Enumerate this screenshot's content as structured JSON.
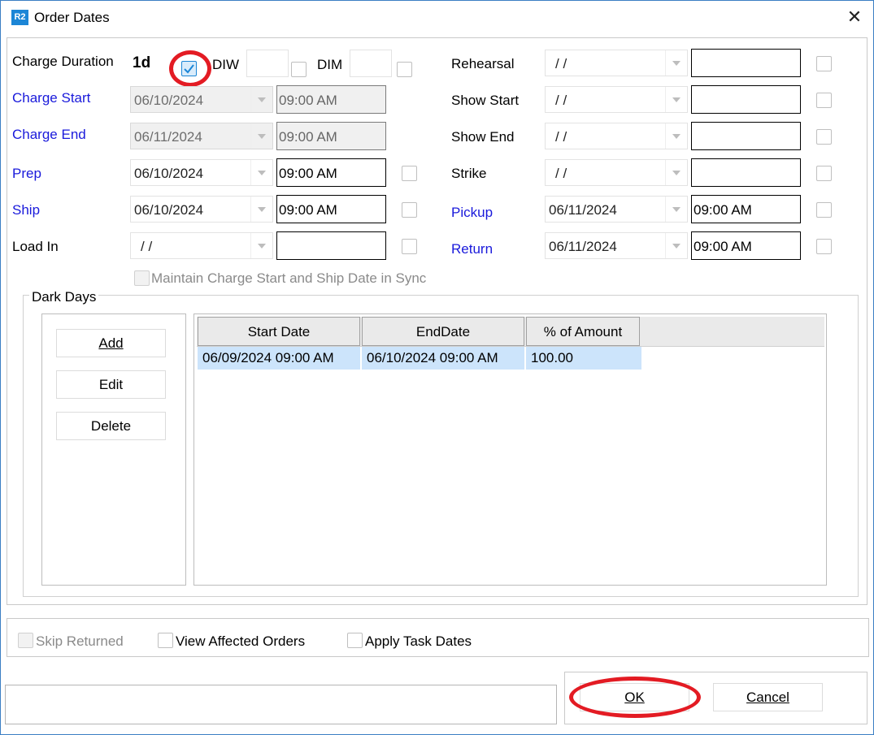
{
  "window": {
    "app_icon_text": "R2",
    "title": "Order Dates",
    "close_glyph": "✕"
  },
  "top": {
    "charge_duration_label": "Charge Duration",
    "charge_duration_value": "1d",
    "diw_label": "DIW",
    "dim_label": "DIM"
  },
  "left_rows": [
    {
      "label": "Charge Start",
      "date": "06/10/2024",
      "time": "09:00 AM"
    },
    {
      "label": "Charge End",
      "date": "06/11/2024",
      "time": "09:00 AM"
    },
    {
      "label": "Prep",
      "date": "06/10/2024",
      "time": "09:00 AM"
    },
    {
      "label": "Ship",
      "date": "06/10/2024",
      "time": "09:00 AM"
    },
    {
      "label": "Load In",
      "date": " /  /",
      "time": ""
    }
  ],
  "right_rows": [
    {
      "label": "Rehearsal",
      "date": " /  /",
      "time": ""
    },
    {
      "label": "Show Start",
      "date": " /  /",
      "time": ""
    },
    {
      "label": "Show End",
      "date": " /  /",
      "time": ""
    },
    {
      "label": "Strike",
      "date": " /  /",
      "time": ""
    },
    {
      "label": "Pickup",
      "date": "06/11/2024",
      "time": "09:00 AM"
    },
    {
      "label": "Return",
      "date": "06/11/2024",
      "time": "09:00 AM"
    }
  ],
  "maintain_sync_label": "Maintain Charge Start and Ship Date in Sync",
  "dark_days": {
    "group_label": "Dark Days",
    "buttons": {
      "add": "Add",
      "edit": "Edit",
      "delete": "Delete"
    },
    "columns": [
      "Start Date",
      "EndDate",
      "% of Amount"
    ],
    "rows": [
      [
        "06/09/2024 09:00 AM",
        "06/10/2024 09:00 AM",
        "100.00"
      ]
    ]
  },
  "options": {
    "skip_returned": "Skip Returned",
    "view_affected_orders": "View Affected Orders",
    "apply_task_dates": "Apply Task Dates"
  },
  "footer": {
    "ok": "OK",
    "cancel": "Cancel",
    "status_text": ""
  },
  "colors": {
    "label_blue": "#1a1adb",
    "highlight_red": "#e31b23",
    "selection": "#cce4fb",
    "check_blue": "#1c86d6"
  }
}
